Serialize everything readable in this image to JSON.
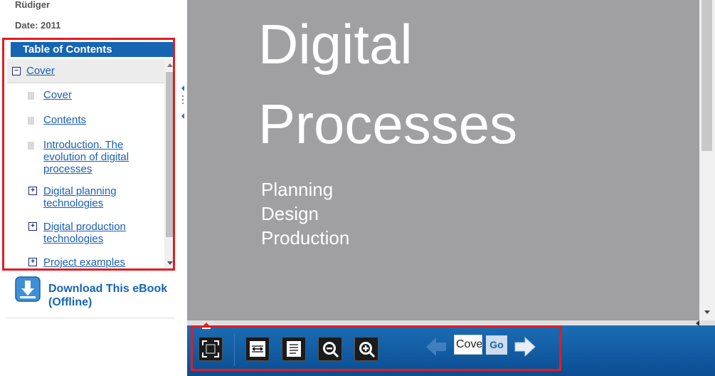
{
  "sidebar": {
    "author": "Rüdiger",
    "date": "Date: 2011",
    "toc": {
      "header": "Table of Contents",
      "root_label": "Cover",
      "items": [
        {
          "label": "Cover"
        },
        {
          "label": "Contents"
        },
        {
          "label_lines": [
            "Introduction. The",
            "evolution of digital",
            "processes"
          ]
        },
        {
          "label_lines": [
            "Digital planning",
            "technologies"
          ]
        },
        {
          "label_lines": [
            "Digital production",
            "technologies"
          ]
        },
        {
          "label": "Project examples"
        }
      ]
    },
    "download": {
      "line1": "Download This eBook",
      "line2": "(Offline)"
    }
  },
  "viewer": {
    "title_line1": "Digital",
    "title_line2": "Processes",
    "subtitle_lines": [
      "Planning",
      "Design",
      "Production"
    ]
  },
  "toolbar": {
    "page_value": "Cover",
    "go_label": "Go",
    "buttons": [
      "fullscreen-icon",
      "fit-width-icon",
      "fit-page-icon",
      "zoom-out-icon",
      "zoom-in-icon"
    ]
  },
  "colors": {
    "toc_header": "#1565b3",
    "link": "#1a5fb4",
    "viewer_bg": "#a0a0a3",
    "toolbar": "#0b4d92",
    "highlight": "#e31b23"
  }
}
